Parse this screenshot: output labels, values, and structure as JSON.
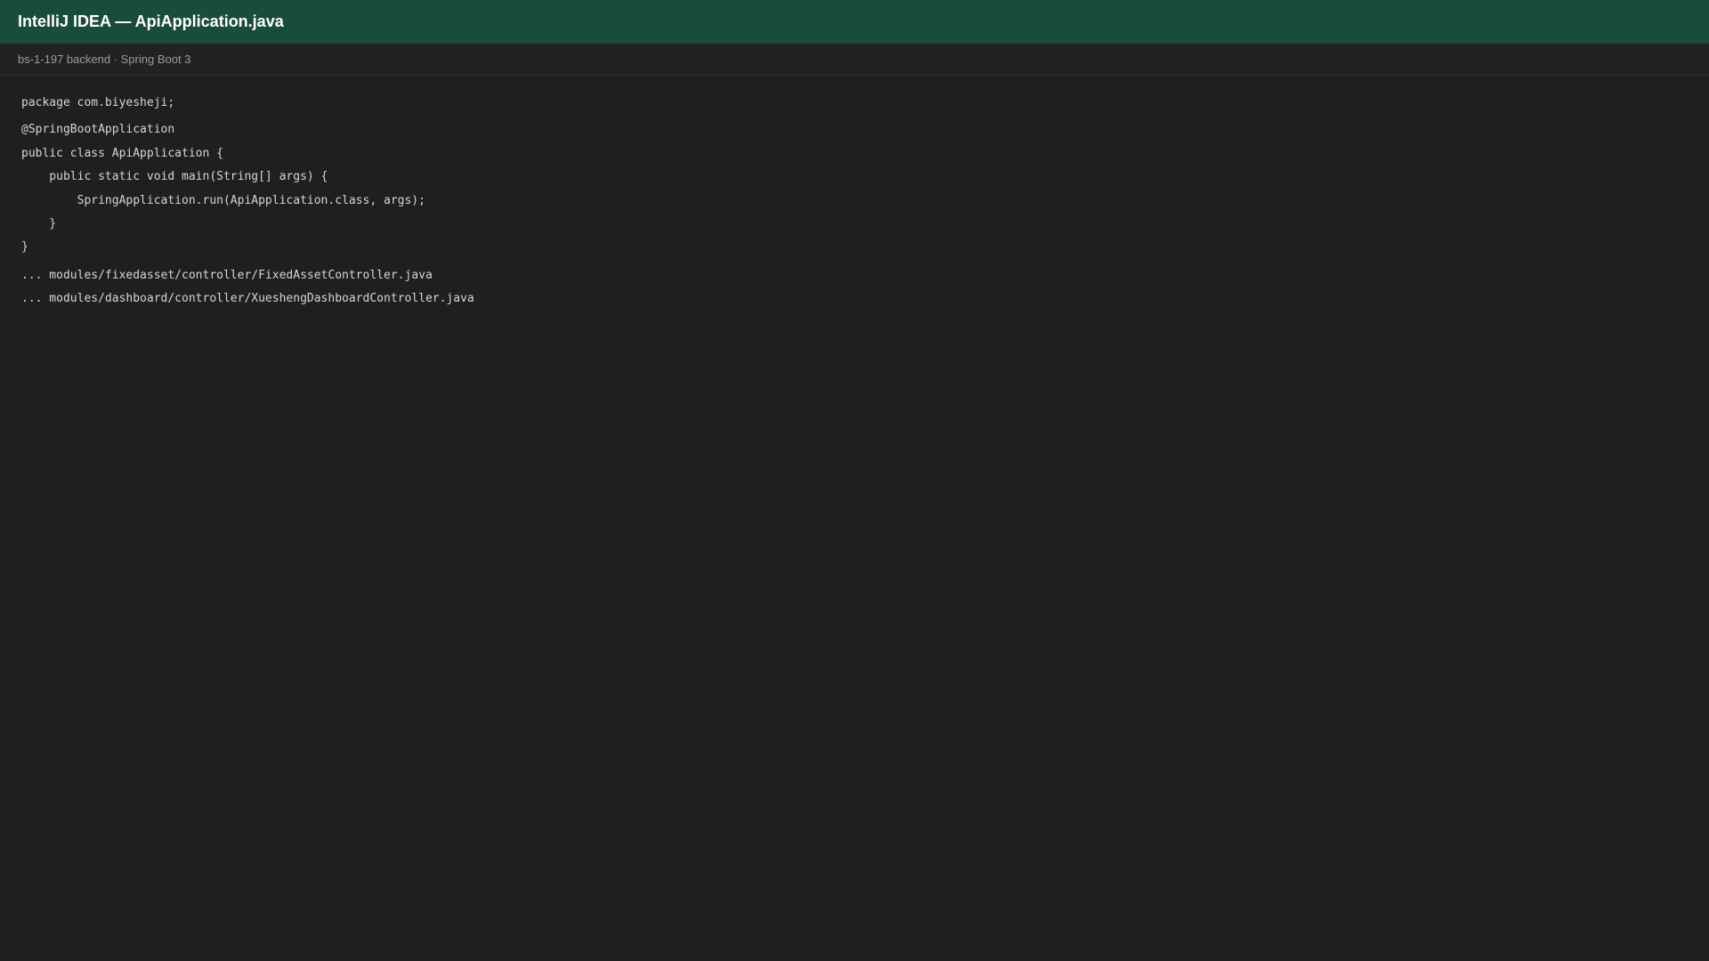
{
  "window": {
    "title": "IntelliJ IDEA — ApiApplication.java",
    "subtitle": "bs-1-197 backend · Spring Boot 3"
  },
  "colors": {
    "title_bar": "#1a4c3e",
    "background": "#1f1f1f",
    "text": "#d6d6d6",
    "subtext": "#9a9a9a"
  },
  "code": {
    "lines": [
      "package com.biyesheji;",
      "@SpringBootApplication",
      "public class ApiApplication {",
      "    public static void main(String[] args) {",
      "        SpringApplication.run(ApiApplication.class, args);",
      "    }",
      "}",
      "... modules/fixedasset/controller/FixedAssetController.java",
      "... modules/dashboard/controller/XueshengDashboardController.java"
    ]
  }
}
